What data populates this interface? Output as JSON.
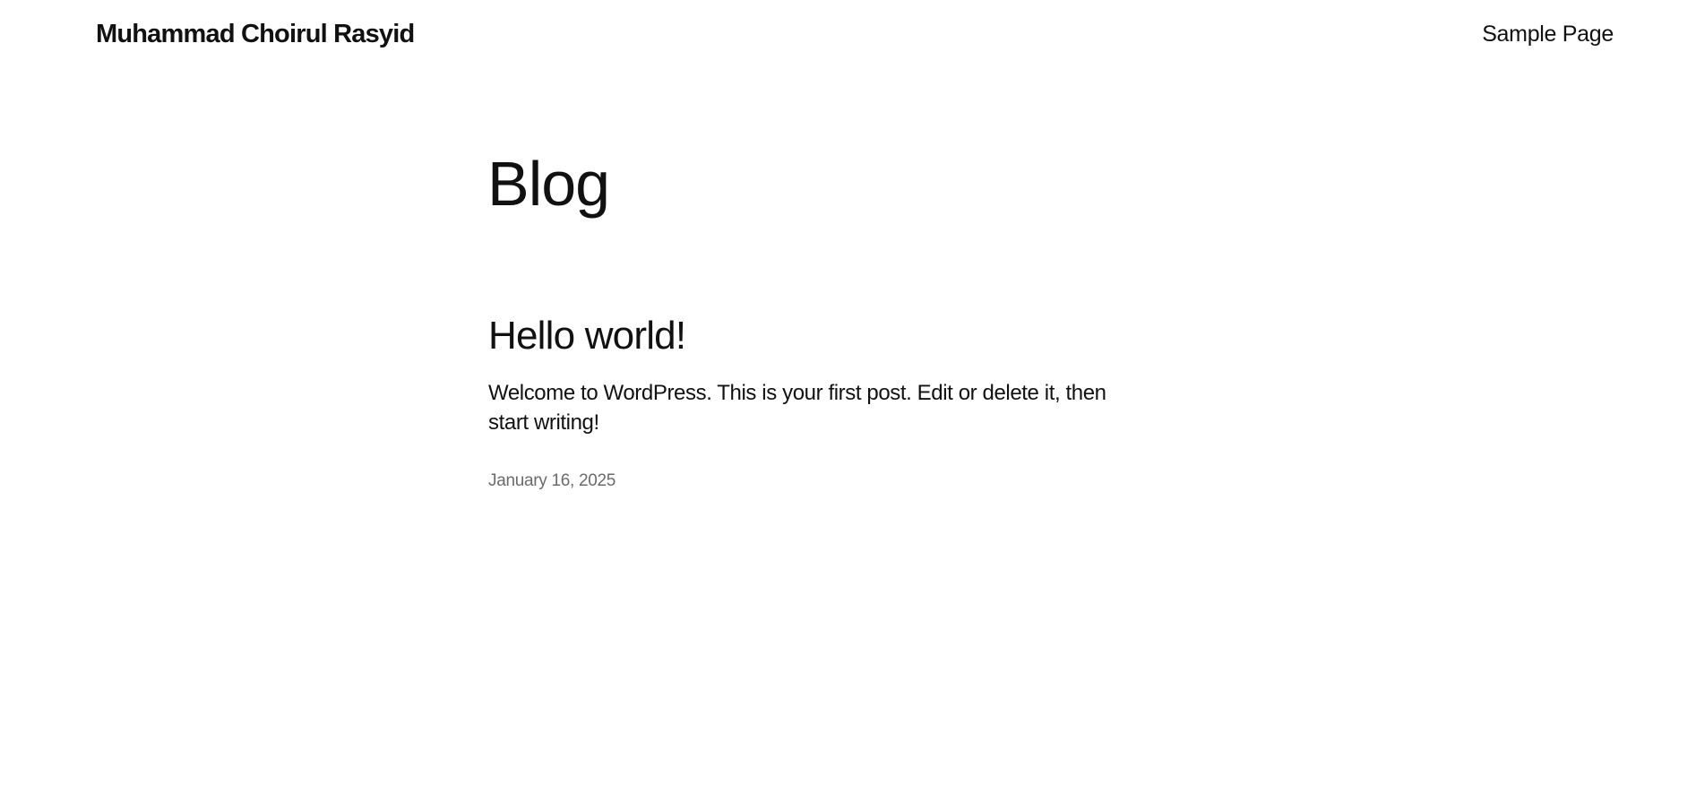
{
  "header": {
    "site_title": "Muhammad Choirul Rasyid",
    "nav": [
      {
        "label": "Sample Page"
      }
    ]
  },
  "main": {
    "page_title": "Blog",
    "posts": [
      {
        "title": "Hello world!",
        "excerpt": "Welcome to WordPress. This is your first post. Edit or delete it, then start writing!",
        "date": "January 16, 2025"
      }
    ]
  }
}
